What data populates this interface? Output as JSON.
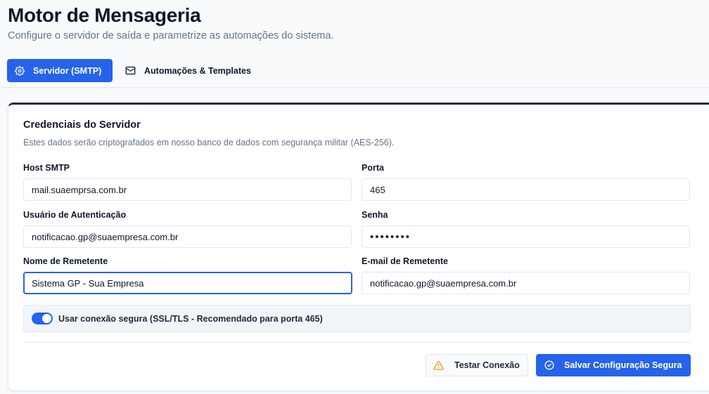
{
  "header": {
    "title": "Motor de Mensageria",
    "subtitle": "Configure o servidor de saída e parametrize as automações do sistema."
  },
  "tabs": [
    {
      "label": "Servidor (SMTP)",
      "icon": "gear-icon",
      "active": true
    },
    {
      "label": "Automações & Templates",
      "icon": "mail-icon",
      "active": false
    }
  ],
  "card": {
    "title": "Credenciais do Servidor",
    "description": "Estes dados serão criptografados em nosso banco de dados com segurança militar (AES-256).",
    "fields": {
      "host": {
        "label": "Host SMTP",
        "value": "mail.suaemprsa.com.br"
      },
      "port": {
        "label": "Porta",
        "value": "465"
      },
      "user": {
        "label": "Usuário de Autenticação",
        "value": "notificacao.gp@suaempresa.com.br"
      },
      "password": {
        "label": "Senha",
        "value": "••••••••"
      },
      "sender_name": {
        "label": "Nome de Remetente",
        "value": "Sistema GP - Sua Empresa"
      },
      "sender_email": {
        "label": "E-mail de Remetente",
        "value": "notificacao.gp@suaempresa.com.br"
      }
    },
    "ssl": {
      "label": "Usar conexão segura (SSL/TLS - Recomendado para porta 465)",
      "enabled": true
    },
    "buttons": {
      "test": {
        "label": "Testar Conexão",
        "icon": "warning-icon"
      },
      "save": {
        "label": "Salvar Configuração Segura",
        "icon": "check-circle-icon"
      }
    }
  },
  "colors": {
    "accent": "#2563eb",
    "warning": "#f59e0b",
    "text": "#0f172a",
    "muted": "#64748b"
  }
}
